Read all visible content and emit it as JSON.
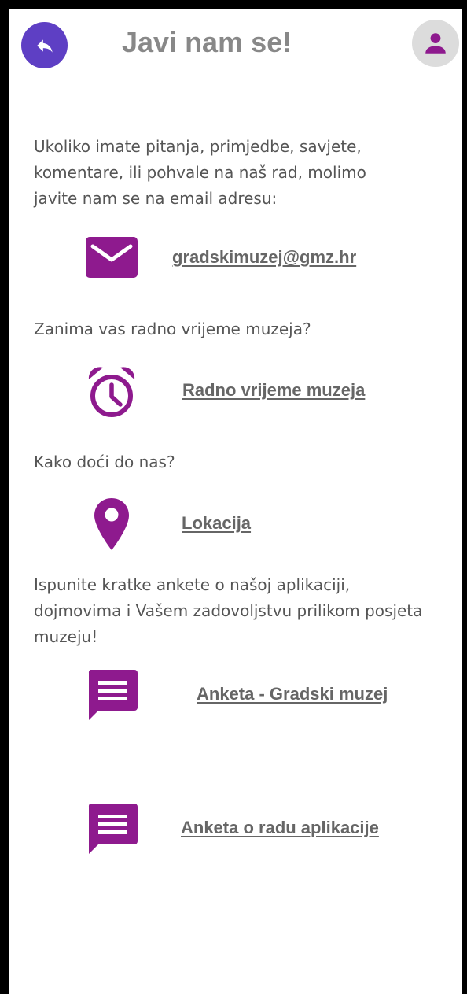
{
  "header": {
    "title": "Javi nam se!"
  },
  "content": {
    "intro_text": "Ukoliko imate pitanja, primjedbe, savjete, komentare, ili pohvale na naš rad, molimo javite nam se na email adresu:",
    "email_link": " gradskimuzej@gmz.hr",
    "hours_question": "Zanima vas radno vrijeme muzeja?",
    "hours_link": "Radno vrijeme muzeja",
    "location_question": "Kako doći do nas?",
    "location_link": "Lokacija",
    "survey_text": "Ispunite kratke ankete o našoj aplikaciji, dojmovima i Vašem zadovoljstvu prilikom posjeta muzeju!",
    "survey_museum_link": "Anketa - Gradski muzej",
    "survey_app_link": "Anketa o radu aplikacije"
  },
  "colors": {
    "accent_purple": "#8e1a8e",
    "back_button": "#5e3fc4",
    "profile_button_bg": "#dcdcdc",
    "title": "#888888",
    "body_text": "#555555",
    "link_text": "#666666"
  },
  "icons": {
    "back": "reply-arrow-icon",
    "profile": "person-icon",
    "email": "envelope-icon",
    "hours": "alarm-clock-icon",
    "location": "map-pin-icon",
    "survey": "chat-message-icon"
  }
}
